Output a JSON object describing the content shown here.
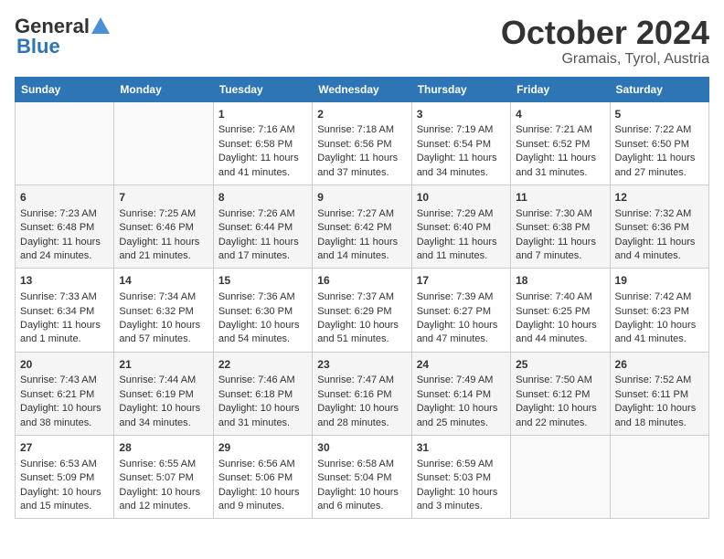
{
  "header": {
    "logo_general": "General",
    "logo_blue": "Blue",
    "title": "October 2024",
    "subtitle": "Gramais, Tyrol, Austria"
  },
  "days_of_week": [
    "Sunday",
    "Monday",
    "Tuesday",
    "Wednesday",
    "Thursday",
    "Friday",
    "Saturday"
  ],
  "weeks": [
    [
      {
        "day": "",
        "content": ""
      },
      {
        "day": "",
        "content": ""
      },
      {
        "day": "1",
        "content": "Sunrise: 7:16 AM\nSunset: 6:58 PM\nDaylight: 11 hours and 41 minutes."
      },
      {
        "day": "2",
        "content": "Sunrise: 7:18 AM\nSunset: 6:56 PM\nDaylight: 11 hours and 37 minutes."
      },
      {
        "day": "3",
        "content": "Sunrise: 7:19 AM\nSunset: 6:54 PM\nDaylight: 11 hours and 34 minutes."
      },
      {
        "day": "4",
        "content": "Sunrise: 7:21 AM\nSunset: 6:52 PM\nDaylight: 11 hours and 31 minutes."
      },
      {
        "day": "5",
        "content": "Sunrise: 7:22 AM\nSunset: 6:50 PM\nDaylight: 11 hours and 27 minutes."
      }
    ],
    [
      {
        "day": "6",
        "content": "Sunrise: 7:23 AM\nSunset: 6:48 PM\nDaylight: 11 hours and 24 minutes."
      },
      {
        "day": "7",
        "content": "Sunrise: 7:25 AM\nSunset: 6:46 PM\nDaylight: 11 hours and 21 minutes."
      },
      {
        "day": "8",
        "content": "Sunrise: 7:26 AM\nSunset: 6:44 PM\nDaylight: 11 hours and 17 minutes."
      },
      {
        "day": "9",
        "content": "Sunrise: 7:27 AM\nSunset: 6:42 PM\nDaylight: 11 hours and 14 minutes."
      },
      {
        "day": "10",
        "content": "Sunrise: 7:29 AM\nSunset: 6:40 PM\nDaylight: 11 hours and 11 minutes."
      },
      {
        "day": "11",
        "content": "Sunrise: 7:30 AM\nSunset: 6:38 PM\nDaylight: 11 hours and 7 minutes."
      },
      {
        "day": "12",
        "content": "Sunrise: 7:32 AM\nSunset: 6:36 PM\nDaylight: 11 hours and 4 minutes."
      }
    ],
    [
      {
        "day": "13",
        "content": "Sunrise: 7:33 AM\nSunset: 6:34 PM\nDaylight: 11 hours and 1 minute."
      },
      {
        "day": "14",
        "content": "Sunrise: 7:34 AM\nSunset: 6:32 PM\nDaylight: 10 hours and 57 minutes."
      },
      {
        "day": "15",
        "content": "Sunrise: 7:36 AM\nSunset: 6:30 PM\nDaylight: 10 hours and 54 minutes."
      },
      {
        "day": "16",
        "content": "Sunrise: 7:37 AM\nSunset: 6:29 PM\nDaylight: 10 hours and 51 minutes."
      },
      {
        "day": "17",
        "content": "Sunrise: 7:39 AM\nSunset: 6:27 PM\nDaylight: 10 hours and 47 minutes."
      },
      {
        "day": "18",
        "content": "Sunrise: 7:40 AM\nSunset: 6:25 PM\nDaylight: 10 hours and 44 minutes."
      },
      {
        "day": "19",
        "content": "Sunrise: 7:42 AM\nSunset: 6:23 PM\nDaylight: 10 hours and 41 minutes."
      }
    ],
    [
      {
        "day": "20",
        "content": "Sunrise: 7:43 AM\nSunset: 6:21 PM\nDaylight: 10 hours and 38 minutes."
      },
      {
        "day": "21",
        "content": "Sunrise: 7:44 AM\nSunset: 6:19 PM\nDaylight: 10 hours and 34 minutes."
      },
      {
        "day": "22",
        "content": "Sunrise: 7:46 AM\nSunset: 6:18 PM\nDaylight: 10 hours and 31 minutes."
      },
      {
        "day": "23",
        "content": "Sunrise: 7:47 AM\nSunset: 6:16 PM\nDaylight: 10 hours and 28 minutes."
      },
      {
        "day": "24",
        "content": "Sunrise: 7:49 AM\nSunset: 6:14 PM\nDaylight: 10 hours and 25 minutes."
      },
      {
        "day": "25",
        "content": "Sunrise: 7:50 AM\nSunset: 6:12 PM\nDaylight: 10 hours and 22 minutes."
      },
      {
        "day": "26",
        "content": "Sunrise: 7:52 AM\nSunset: 6:11 PM\nDaylight: 10 hours and 18 minutes."
      }
    ],
    [
      {
        "day": "27",
        "content": "Sunrise: 6:53 AM\nSunset: 5:09 PM\nDaylight: 10 hours and 15 minutes."
      },
      {
        "day": "28",
        "content": "Sunrise: 6:55 AM\nSunset: 5:07 PM\nDaylight: 10 hours and 12 minutes."
      },
      {
        "day": "29",
        "content": "Sunrise: 6:56 AM\nSunset: 5:06 PM\nDaylight: 10 hours and 9 minutes."
      },
      {
        "day": "30",
        "content": "Sunrise: 6:58 AM\nSunset: 5:04 PM\nDaylight: 10 hours and 6 minutes."
      },
      {
        "day": "31",
        "content": "Sunrise: 6:59 AM\nSunset: 5:03 PM\nDaylight: 10 hours and 3 minutes."
      },
      {
        "day": "",
        "content": ""
      },
      {
        "day": "",
        "content": ""
      }
    ]
  ]
}
